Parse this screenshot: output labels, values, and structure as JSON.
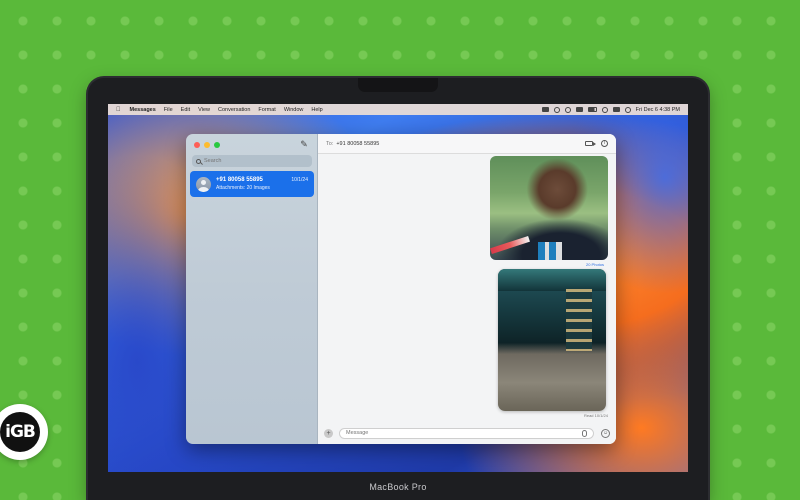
{
  "menubar": {
    "app_name": "Messages",
    "items": [
      "File",
      "Edit",
      "View",
      "Conversation",
      "Format",
      "Window",
      "Help"
    ],
    "clock": "Fri Dec 6  4:38 PM"
  },
  "sidebar": {
    "search_placeholder": "Search",
    "conversations": [
      {
        "name": "+91 80058 55895",
        "date": "10/1/24",
        "preview": "Attachments: 20 Images"
      }
    ]
  },
  "chat": {
    "to_label": "To:",
    "recipient": "+91 80058 55895",
    "photos_label": "20 Photos",
    "read_receipt": "Read 10/1/24",
    "message_placeholder": "Message"
  },
  "device": {
    "brand": "MacBook Pro"
  },
  "logo": {
    "text": "iGB"
  }
}
